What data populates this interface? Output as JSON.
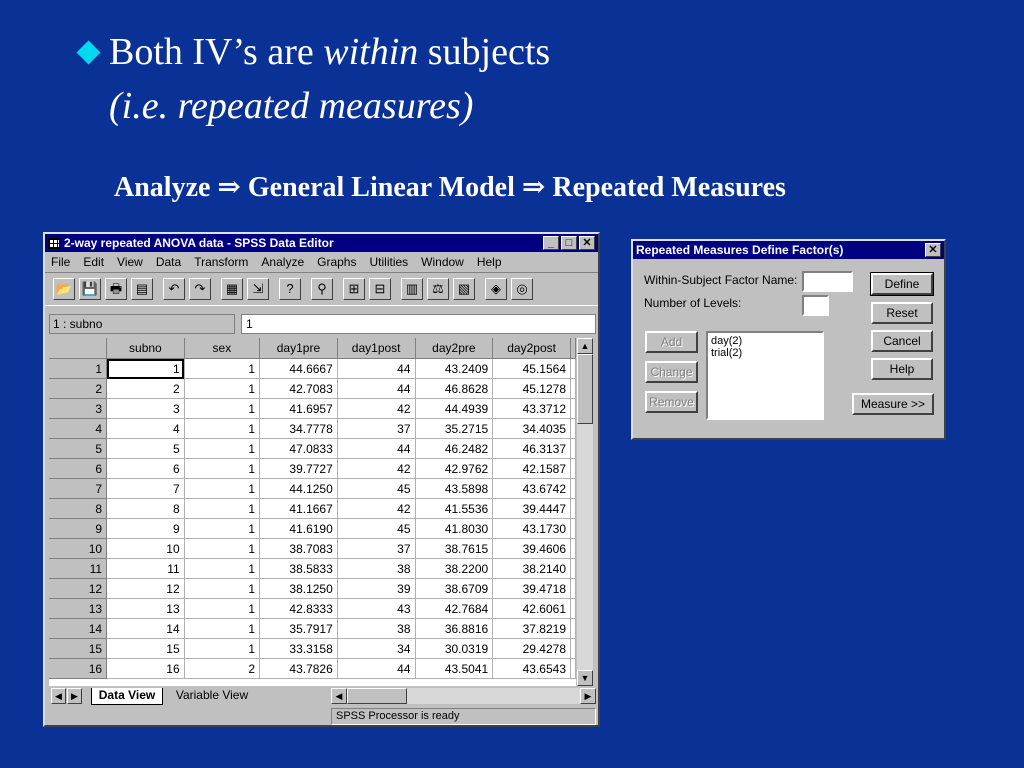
{
  "slide": {
    "bullet_text": "Both IV’s are ",
    "bullet_emph": "within",
    "bullet_tail": " subjects",
    "subline": "(i.e. repeated measures)",
    "menu_path": "Analyze ⇒ General Linear Model ⇒ Repeated Measures",
    "colors": {
      "background": "#0a3296",
      "bullet": "#00d8f0",
      "text": "#ffffff"
    }
  },
  "editor": {
    "title": "2-way repeated ANOVA data - SPSS Data Editor",
    "menu": [
      "File",
      "Edit",
      "View",
      "Data",
      "Transform",
      "Analyze",
      "Graphs",
      "Utilities",
      "Window",
      "Help"
    ],
    "toolbar_icons": [
      "open-icon",
      "save-icon",
      "print-icon",
      "dialog-recall-icon",
      "undo-icon",
      "redo-icon",
      "goto-chart-icon",
      "goto-case-icon",
      "variables-icon",
      "find-icon",
      "insert-case-icon",
      "insert-variable-icon",
      "split-file-icon",
      "weight-cases-icon",
      "select-cases-icon",
      "value-labels-icon",
      "use-sets-icon"
    ],
    "cell_ref": "1 : subno",
    "cell_value": "1",
    "columns": [
      "subno",
      "sex",
      "day1pre",
      "day1post",
      "day2pre",
      "day2post"
    ],
    "rows": [
      [
        "1",
        "1",
        "44.6667",
        "44",
        "43.2409",
        "45.1564"
      ],
      [
        "2",
        "1",
        "42.7083",
        "44",
        "46.8628",
        "45.1278"
      ],
      [
        "3",
        "1",
        "41.6957",
        "42",
        "44.4939",
        "43.3712"
      ],
      [
        "4",
        "1",
        "34.7778",
        "37",
        "35.2715",
        "34.4035"
      ],
      [
        "5",
        "1",
        "47.0833",
        "44",
        "46.2482",
        "46.3137"
      ],
      [
        "6",
        "1",
        "39.7727",
        "42",
        "42.9762",
        "42.1587"
      ],
      [
        "7",
        "1",
        "44.1250",
        "45",
        "43.5898",
        "43.6742"
      ],
      [
        "8",
        "1",
        "41.1667",
        "42",
        "41.5536",
        "39.4447"
      ],
      [
        "9",
        "1",
        "41.6190",
        "45",
        "41.8030",
        "43.1730"
      ],
      [
        "10",
        "1",
        "38.7083",
        "37",
        "38.7615",
        "39.4606"
      ],
      [
        "11",
        "1",
        "38.5833",
        "38",
        "38.2200",
        "38.2140"
      ],
      [
        "12",
        "1",
        "38.1250",
        "39",
        "38.6709",
        "39.4718"
      ],
      [
        "13",
        "1",
        "42.8333",
        "43",
        "42.7684",
        "42.6061"
      ],
      [
        "14",
        "1",
        "35.7917",
        "38",
        "36.8816",
        "37.8219"
      ],
      [
        "15",
        "1",
        "33.3158",
        "34",
        "30.0319",
        "29.4278"
      ],
      [
        "16",
        "2",
        "43.7826",
        "44",
        "43.5041",
        "43.6543"
      ]
    ],
    "tabs": {
      "data_view": "Data View",
      "variable_view": "Variable View"
    },
    "status": "SPSS Processor  is ready"
  },
  "dialog": {
    "title": "Repeated Measures Define Factor(s)",
    "factor_name_label": "Within-Subject Factor Name:",
    "levels_label": "Number of Levels:",
    "factor_name_value": "",
    "levels_value": "",
    "factors": [
      "day(2)",
      "trial(2)"
    ],
    "buttons": {
      "define": "Define",
      "reset": "Reset",
      "cancel": "Cancel",
      "help": "Help",
      "add": "Add",
      "change": "Change",
      "remove": "Remove",
      "measure": "Measure >>"
    }
  }
}
